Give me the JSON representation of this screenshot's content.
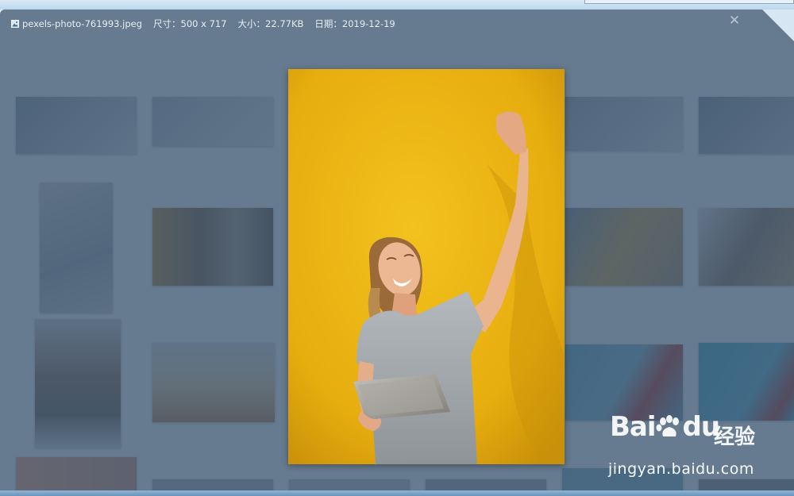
{
  "viewer": {
    "file_name": "pexels-photo-761993.jpeg",
    "size_label": "尺寸：500 x 717",
    "filesize_label": "大小：22.77KB",
    "date_label": "日期：2019-12-19"
  },
  "icons": {
    "file": "image-file-icon",
    "close": "close-icon"
  },
  "close_glyph": "✕",
  "watermark": {
    "brand": "Bai",
    "brand_suffix": "du",
    "brand_cn": "经验",
    "site": "jingyan.baidu.com"
  },
  "colors": {
    "overlay": "#344e68",
    "photo_background": "#e8b412",
    "info_text": "#e9eef3"
  }
}
